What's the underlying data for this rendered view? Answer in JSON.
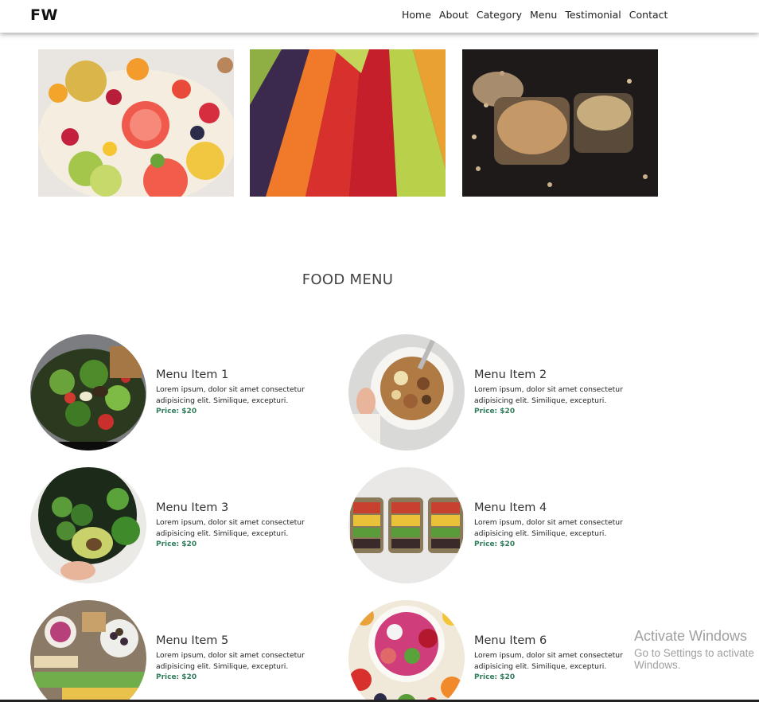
{
  "header": {
    "brand": "FW",
    "nav": [
      "Home",
      "About",
      "Category",
      "Menu",
      "Testimonial",
      "Contact"
    ]
  },
  "gallery": [
    {
      "subject": "fruit-platter"
    },
    {
      "subject": "vegetable-rows"
    },
    {
      "subject": "beans-in-jars"
    }
  ],
  "food_menu": {
    "title": "FOOD MENU",
    "items": [
      {
        "name": "Menu Item 1",
        "desc": "Lorem ipsum, dolor sit amet consectetur adipisicing elit. Similique, excepturi.",
        "price": "Price: $20"
      },
      {
        "name": "Menu Item 2",
        "desc": "Lorem ipsum, dolor sit amet consectetur adipisicing elit. Similique, excepturi.",
        "price": "Price: $20"
      },
      {
        "name": "Menu Item 3",
        "desc": "Lorem ipsum, dolor sit amet consectetur adipisicing elit. Similique, excepturi.",
        "price": "Price: $20"
      },
      {
        "name": "Menu Item 4",
        "desc": "Lorem ipsum, dolor sit amet consectetur adipisicing elit. Similique, excepturi.",
        "price": "Price: $20"
      },
      {
        "name": "Menu Item 5",
        "desc": "Lorem ipsum, dolor sit amet consectetur adipisicing elit. Similique, excepturi.",
        "price": "Price: $20"
      },
      {
        "name": "Menu Item 6",
        "desc": "Lorem ipsum, dolor sit amet consectetur adipisicing elit. Similique, excepturi.",
        "price": "Price: $20"
      }
    ]
  },
  "watermark": {
    "title": "Activate Windows",
    "subtitle": "Go to Settings to activate Windows."
  },
  "colors": {
    "price": "#2f7d5b",
    "text": "#333333",
    "header_bg": "#ffffff"
  }
}
